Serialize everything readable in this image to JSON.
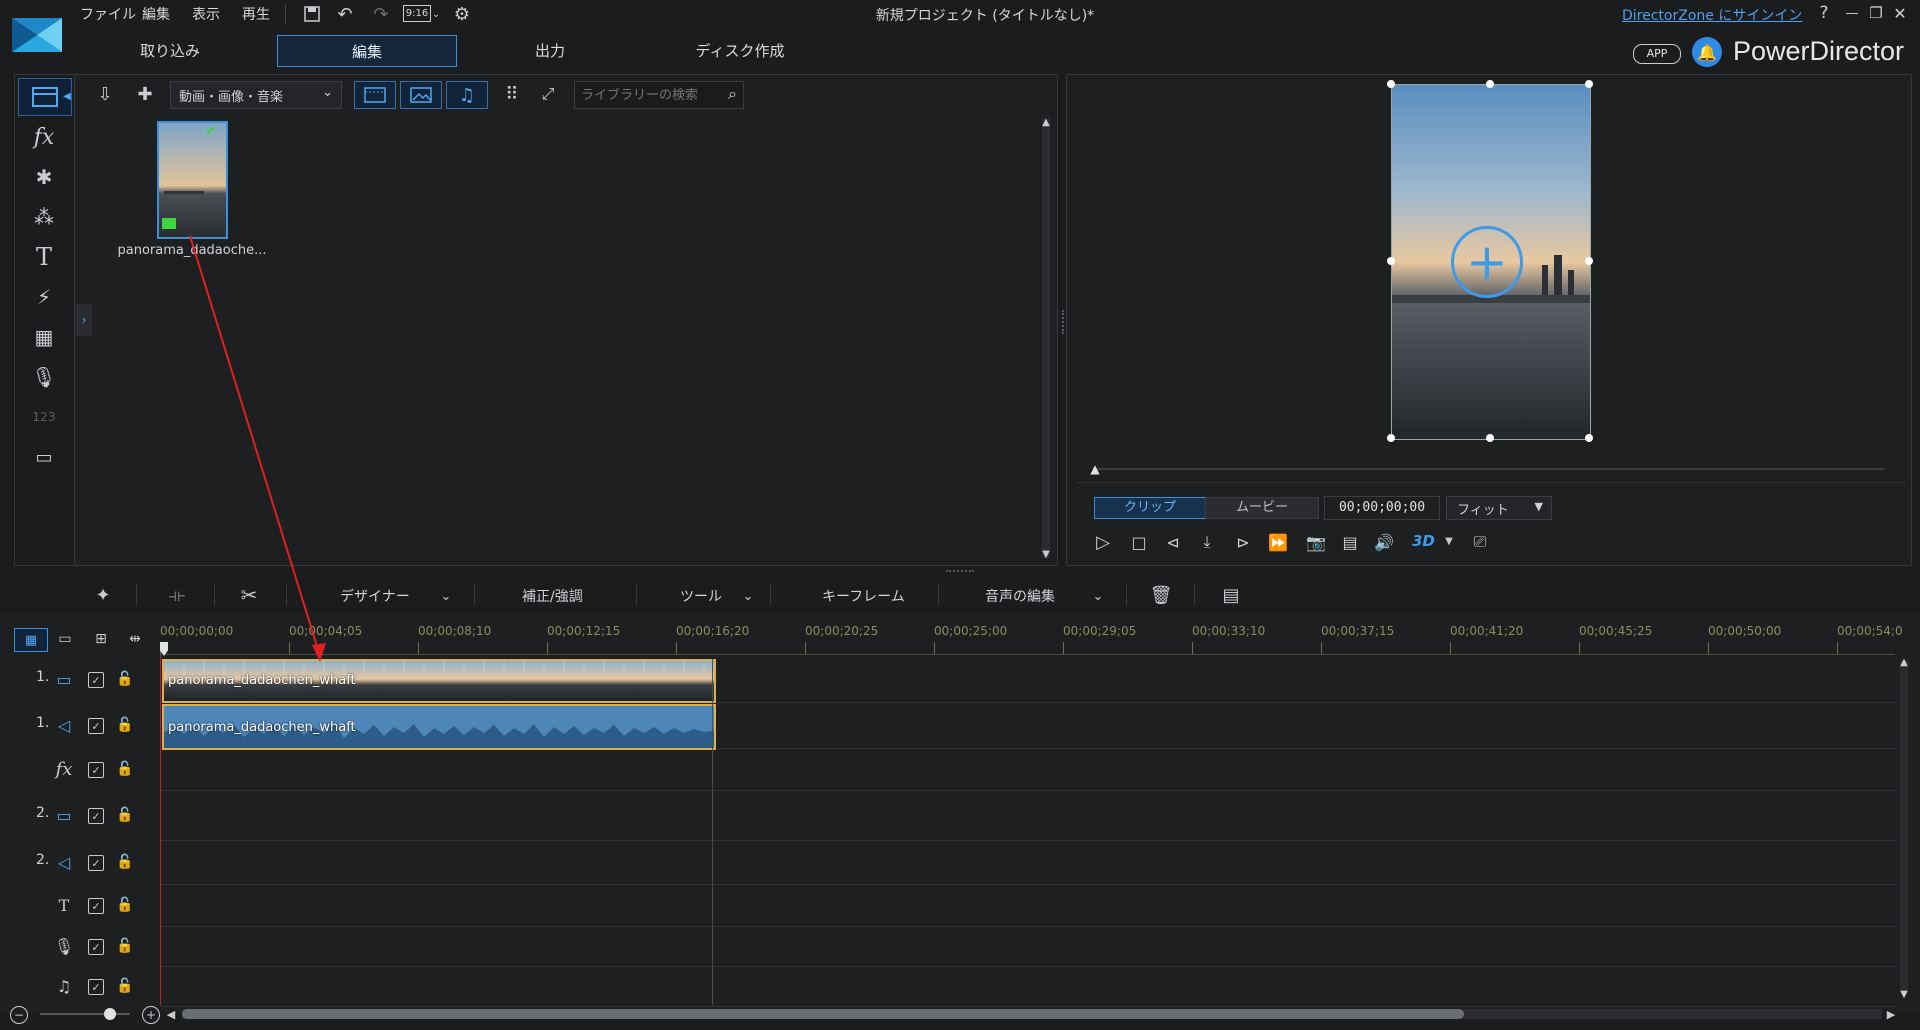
{
  "menu": {
    "file": "ファイル",
    "edit": "編集",
    "view": "表示",
    "play": "再生",
    "aspect": "9:16"
  },
  "window_title": "新規プロジェクト (タイトルなし)*",
  "signin": "DirectorZone にサインイン",
  "win_controls": {
    "help": "?",
    "min": "—",
    "restore": "❐",
    "close": "✕"
  },
  "tabs": {
    "import": "取り込み",
    "edit": "編集",
    "output": "出力",
    "disc": "ディスク作成"
  },
  "brand": {
    "app_badge": "APP",
    "name": "PowerDirector"
  },
  "library": {
    "filter_label": "動画・画像・音楽",
    "search_placeholder": "ライブラリーの検索",
    "media": [
      {
        "name": "panorama_dadaoche..."
      }
    ]
  },
  "preview": {
    "mode_clip": "クリップ",
    "mode_movie": "ムービー",
    "timecode": "00;00;00;00",
    "fit": "フィット",
    "three_d": "3D"
  },
  "timeline_toolbar": {
    "designer": "デザイナー",
    "correction": "補正/強調",
    "tools": "ツール",
    "keyframe": "キーフレーム",
    "audio_edit": "音声の編集"
  },
  "ruler": [
    "00;00;00;00",
    "00;00;04;05",
    "00;00;08;10",
    "00;00;12;15",
    "00;00;16;20",
    "00;00;20;25",
    "00;00;25;00",
    "00;00;29;05",
    "00;00;33;10",
    "00;00;37;15",
    "00;00;41;20",
    "00;00;45;25",
    "00;00;50;00",
    "00;00;54;0"
  ],
  "tracks": [
    {
      "label": "1.",
      "type": "video"
    },
    {
      "label": "1.",
      "type": "audio"
    },
    {
      "label": "",
      "type": "fx"
    },
    {
      "label": "2.",
      "type": "video"
    },
    {
      "label": "2.",
      "type": "audio"
    },
    {
      "label": "",
      "type": "title"
    },
    {
      "label": "",
      "type": "voice"
    },
    {
      "label": "",
      "type": "music"
    }
  ],
  "clips": {
    "video": "panorama_dadaochen_whaft",
    "audio": "panorama_dadaochen_whaft"
  },
  "colors": {
    "accent": "#3c8fd8",
    "arrow": "#e02020",
    "clip_border": "#d8b24a",
    "audio_clip": "#4f86b8"
  }
}
